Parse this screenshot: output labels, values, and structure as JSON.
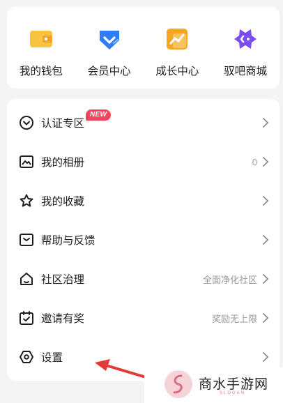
{
  "quick_actions": [
    {
      "label": "我的钱包",
      "icon": "wallet-icon"
    },
    {
      "label": "会员中心",
      "icon": "member-badge-icon"
    },
    {
      "label": "成长中心",
      "icon": "growth-chart-icon"
    },
    {
      "label": "驭吧商城",
      "icon": "shop-icon"
    }
  ],
  "menu": [
    {
      "label": "认证专区",
      "icon": "verified-chevron-icon",
      "badge": "NEW",
      "value": ""
    },
    {
      "label": "我的相册",
      "icon": "album-icon",
      "value": "0"
    },
    {
      "label": "我的收藏",
      "icon": "star-icon",
      "value": ""
    },
    {
      "label": "帮助与反馈",
      "icon": "feedback-icon",
      "value": ""
    },
    {
      "label": "社区治理",
      "icon": "community-house-icon",
      "value": "全面净化社区"
    },
    {
      "label": "邀请有奖",
      "icon": "calendar-check-icon",
      "value": "奖励无上限"
    },
    {
      "label": "设置",
      "icon": "settings-hexagon-icon",
      "value": ""
    }
  ],
  "watermark": {
    "text": "商水手游网",
    "sub": "SLOGAN"
  },
  "colors": {
    "background": "#f4f4f6",
    "badge": "#f2445c",
    "arrow": "#e53935",
    "wallet": "#f7c341",
    "member": "#2f7df6",
    "growth": "#f5a623",
    "shop": "#7b4cf2"
  }
}
